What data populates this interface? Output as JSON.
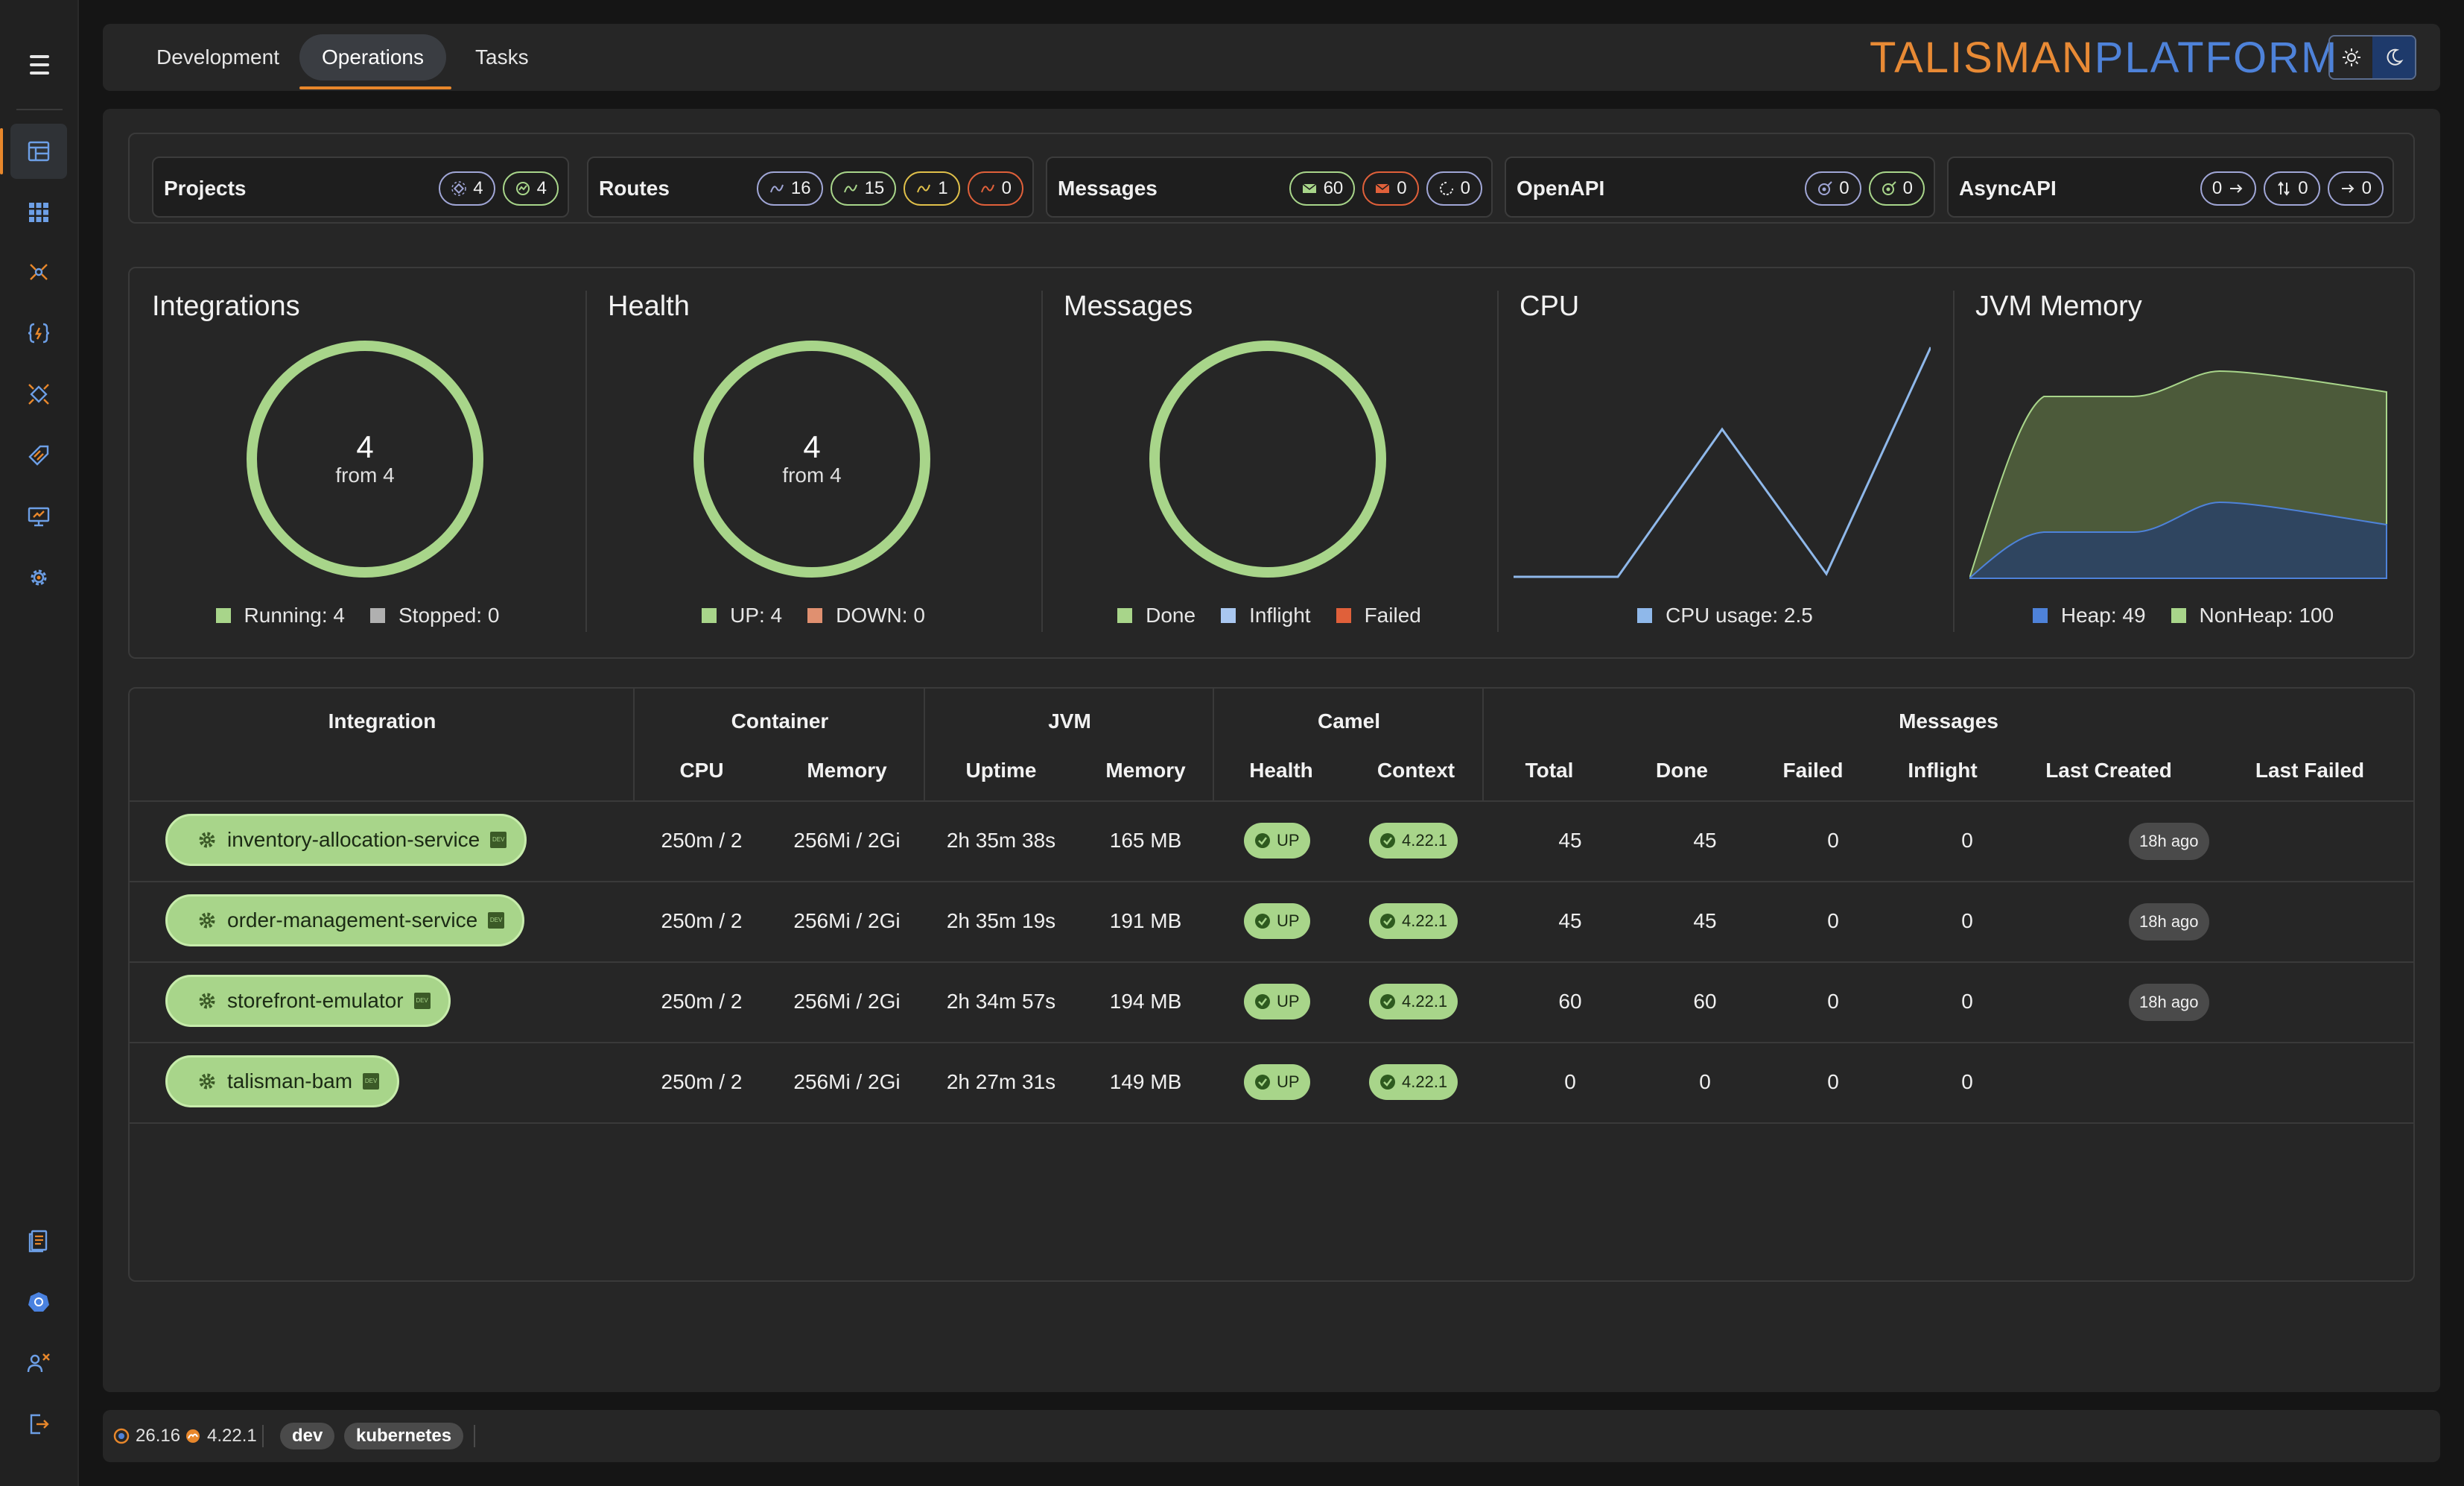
{
  "header": {
    "tabs": [
      {
        "label": "Development"
      },
      {
        "label": "Operations"
      },
      {
        "label": "Tasks"
      }
    ],
    "brand_part1": "TALISMAN",
    "brand_part2": "PLATFORM",
    "theme_light_icon": "sun-icon",
    "theme_dark_icon": "moon-icon"
  },
  "sidebar": {
    "items": [
      {
        "icon": "dashboard-icon",
        "active": true
      },
      {
        "icon": "grid-icon"
      },
      {
        "icon": "network-icon"
      },
      {
        "icon": "code-brackets-icon"
      },
      {
        "icon": "integration-icon"
      },
      {
        "icon": "tag-icon"
      },
      {
        "icon": "monitor-icon"
      },
      {
        "icon": "gear-icon"
      },
      {
        "icon": "document-icon"
      },
      {
        "icon": "kubernetes-icon"
      },
      {
        "icon": "users-icon"
      },
      {
        "icon": "logout-icon"
      }
    ]
  },
  "summary": {
    "projects": {
      "label": "Projects",
      "badges": [
        "4",
        "4"
      ]
    },
    "routes": {
      "label": "Routes",
      "badges": [
        "16",
        "15",
        "1",
        "0"
      ]
    },
    "messages": {
      "label": "Messages",
      "badges": [
        "60",
        "0",
        "0"
      ]
    },
    "openapi": {
      "label": "OpenAPI",
      "badges": [
        "0",
        "0"
      ]
    },
    "asyncapi": {
      "label": "AsyncAPI",
      "badges": [
        "0",
        "0",
        "0"
      ]
    }
  },
  "charts": {
    "integrations": {
      "title": "Integrations",
      "big": "4",
      "small": "from 4",
      "legend": [
        "Running: 4",
        "Stopped: 0"
      ]
    },
    "health": {
      "title": "Health",
      "big": "4",
      "small": "from 4",
      "legend": [
        "UP: 4",
        "DOWN: 0"
      ]
    },
    "messages": {
      "title": "Messages",
      "legend": [
        "Done",
        "Inflight",
        "Failed"
      ]
    },
    "cpu": {
      "title": "CPU",
      "legend": [
        "CPU usage: 2.5"
      ]
    },
    "jvm": {
      "title": "JVM Memory",
      "legend": [
        "Heap: 49",
        "NonHeap: 100"
      ]
    }
  },
  "colors": {
    "accent": "#e8872b",
    "brand_blue": "#4e82d9",
    "green": "#a8d58a",
    "cpu_line": "#8fb8ea",
    "heap": "#4e82d9",
    "nonheap": "#a8d58a",
    "failed": "#e0603a",
    "down": "#e09070",
    "stopped": "#b0b0b0"
  },
  "table": {
    "group_headers": [
      "Integration",
      "Container",
      "JVM",
      "Camel",
      "Messages"
    ],
    "sub_headers": [
      "CPU",
      "Memory",
      "Uptime",
      "Memory",
      "Health",
      "Context",
      "Total",
      "Done",
      "Failed",
      "Inflight",
      "Last Created",
      "Last Failed"
    ],
    "dev_tag": "DEV",
    "rows": [
      {
        "name": "inventory-allocation-service",
        "cpu": "250m / 2",
        "mem": "256Mi / 2Gi",
        "uptime": "2h 35m 38s",
        "jvm_mem": "165 MB",
        "health": "UP",
        "context": "4.22.1",
        "total": "45",
        "done": "45",
        "failed": "0",
        "inflight": "0",
        "last_created": "18h ago",
        "last_failed": ""
      },
      {
        "name": "order-management-service",
        "cpu": "250m / 2",
        "mem": "256Mi / 2Gi",
        "uptime": "2h 35m 19s",
        "jvm_mem": "191 MB",
        "health": "UP",
        "context": "4.22.1",
        "total": "45",
        "done": "45",
        "failed": "0",
        "inflight": "0",
        "last_created": "18h ago",
        "last_failed": ""
      },
      {
        "name": "storefront-emulator",
        "cpu": "250m / 2",
        "mem": "256Mi / 2Gi",
        "uptime": "2h 34m 57s",
        "jvm_mem": "194 MB",
        "health": "UP",
        "context": "4.22.1",
        "total": "60",
        "done": "60",
        "failed": "0",
        "inflight": "0",
        "last_created": "18h ago",
        "last_failed": ""
      },
      {
        "name": "talisman-bam",
        "cpu": "250m / 2",
        "mem": "256Mi / 2Gi",
        "uptime": "2h 27m 31s",
        "jvm_mem": "149 MB",
        "health": "UP",
        "context": "4.22.1",
        "total": "0",
        "done": "0",
        "failed": "0",
        "inflight": "0",
        "last_created": "",
        "last_failed": ""
      }
    ]
  },
  "footer": {
    "version1": "26.16",
    "version2": "4.22.1",
    "env_tag": "dev",
    "platform_tag": "kubernetes"
  }
}
